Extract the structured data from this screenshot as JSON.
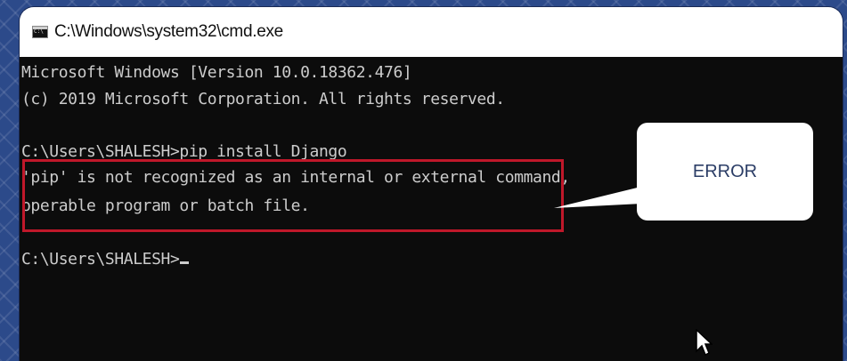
{
  "window": {
    "title": "C:\\Windows\\system32\\cmd.exe",
    "icon": "cmd-icon"
  },
  "console": {
    "lines": [
      "Microsoft Windows [Version 10.0.18362.476]",
      "(c) 2019 Microsoft Corporation. All rights reserved.",
      "",
      "C:\\Users\\SHALESH>pip install Django",
      "'pip' is not recognized as an internal or external command,",
      "operable program or batch file.",
      "",
      "C:\\Users\\SHALESH>"
    ]
  },
  "callout": {
    "label": "ERROR"
  },
  "colors": {
    "background": "#2c4a8a",
    "console_bg": "#0c0c0c",
    "console_text": "#cccccc",
    "error_border": "#c0182a",
    "callout_text": "#2b3d66"
  }
}
